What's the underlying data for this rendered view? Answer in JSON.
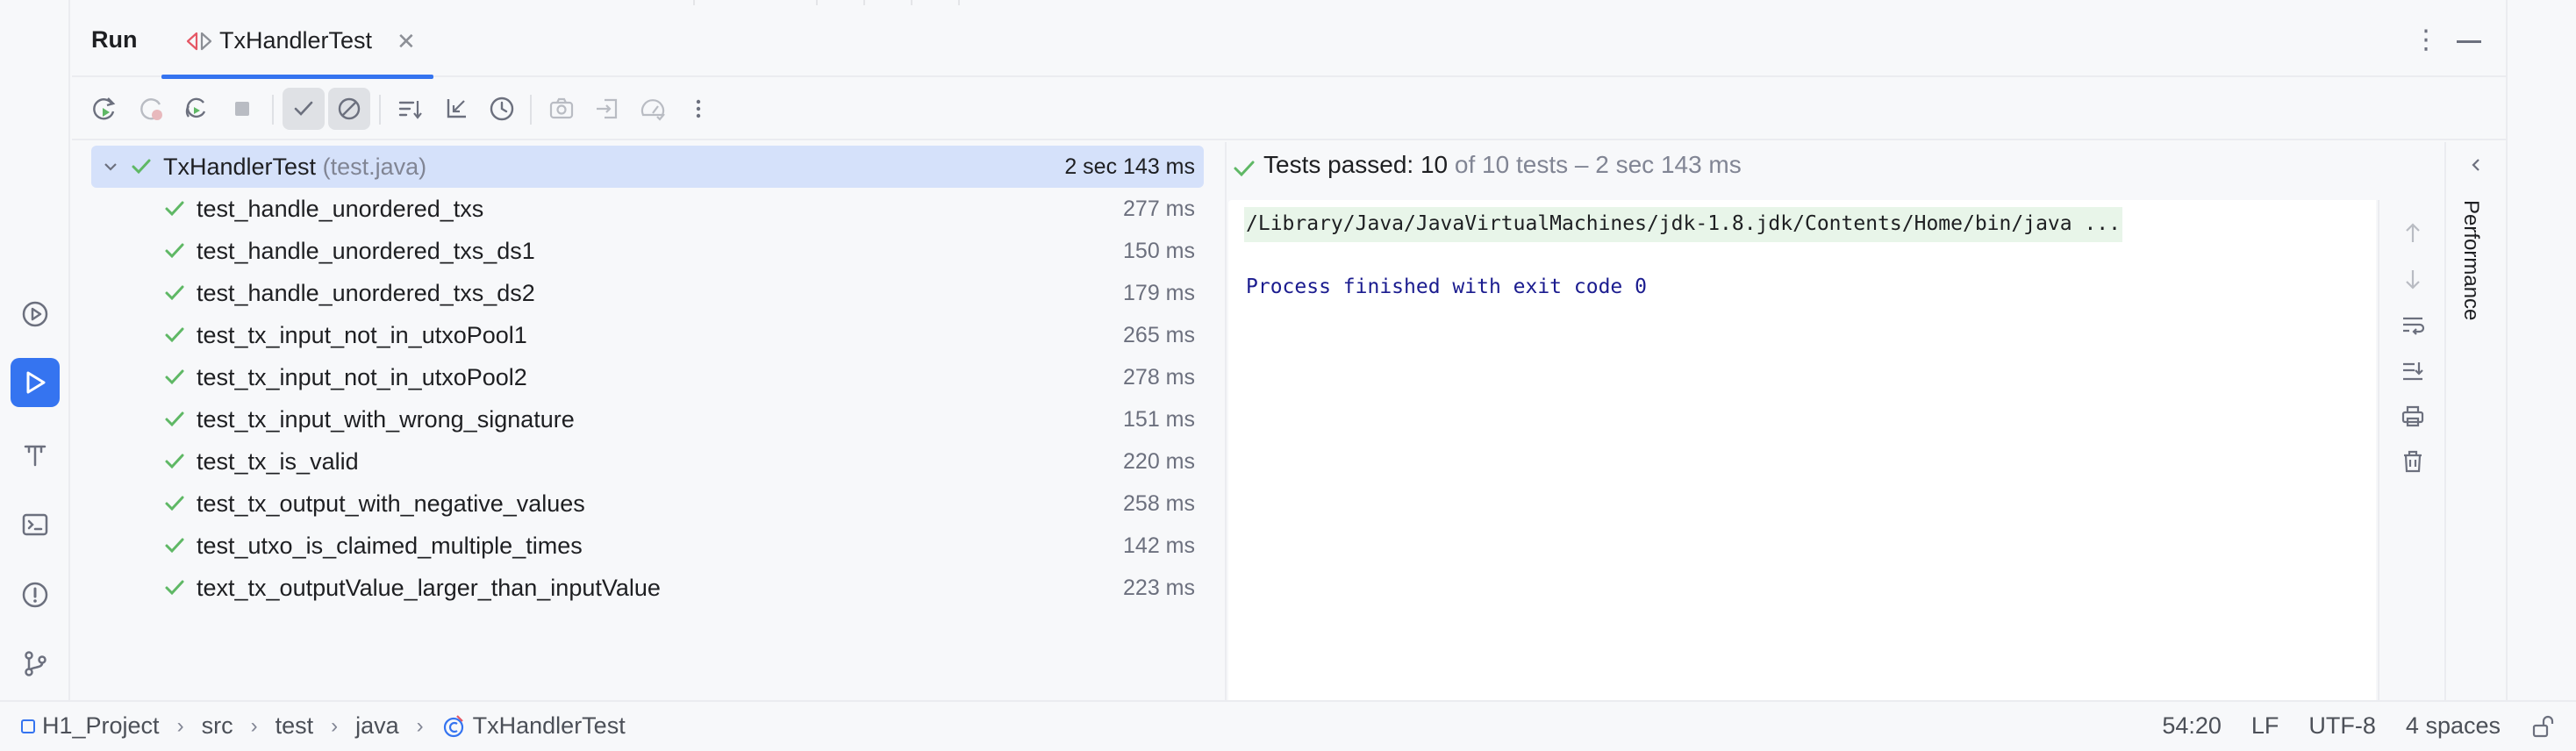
{
  "run_panel": {
    "title": "Run",
    "tab": {
      "label": "TxHandlerTest"
    }
  },
  "toolbar": {
    "buttons": [
      {
        "icon": "rerun-icon"
      },
      {
        "icon": "rerun-failed-icon"
      },
      {
        "icon": "toggle-auto-test-icon"
      },
      {
        "icon": "stop-icon"
      },
      {
        "icon": "show-passed-icon"
      },
      {
        "icon": "show-ignored-icon"
      },
      {
        "icon": "sort-alphabetically-icon"
      },
      {
        "icon": "sort-by-duration-icon"
      },
      {
        "icon": "test-history-icon"
      },
      {
        "icon": "export-icon"
      },
      {
        "icon": "import-icon"
      },
      {
        "icon": "coverage-icon"
      },
      {
        "icon": "more-icon"
      }
    ]
  },
  "tree": {
    "root": {
      "name": "TxHandlerTest",
      "sub": "(test.java)",
      "duration": "2 sec 143 ms"
    },
    "tests": [
      {
        "name": "test_handle_unordered_txs",
        "duration": "277 ms"
      },
      {
        "name": "test_handle_unordered_txs_ds1",
        "duration": "150 ms"
      },
      {
        "name": "test_handle_unordered_txs_ds2",
        "duration": "179 ms"
      },
      {
        "name": "test_tx_input_not_in_utxoPool1",
        "duration": "265 ms"
      },
      {
        "name": "test_tx_input_not_in_utxoPool2",
        "duration": "278 ms"
      },
      {
        "name": "test_tx_input_with_wrong_signature",
        "duration": "151 ms"
      },
      {
        "name": "test_tx_is_valid",
        "duration": "220 ms"
      },
      {
        "name": "test_tx_output_with_negative_values",
        "duration": "258 ms"
      },
      {
        "name": "test_utxo_is_claimed_multiple_times",
        "duration": "142 ms"
      },
      {
        "name": "text_tx_outputValue_larger_than_inputValue",
        "duration": "223 ms"
      }
    ]
  },
  "status": {
    "label": "Tests passed: ",
    "passed": "10",
    "rest": " of 10 tests – 2 sec 143 ms"
  },
  "console": {
    "command": "/Library/Java/JavaVirtualMachines/jdk-1.8.jdk/Contents/Home/bin/java ...",
    "exit_message": "Process finished with exit code 0"
  },
  "right_strip": {
    "performance_label": "Performance"
  },
  "statusbar": {
    "breadcrumbs": [
      "H1_Project",
      "src",
      "test",
      "java",
      "TxHandlerTest"
    ],
    "position": "54:20",
    "line_ending": "LF",
    "encoding": "UTF-8",
    "indent": "4 spaces"
  },
  "colors": {
    "accent": "#3574f0",
    "success": "#5fb865",
    "selection": "#d5e1fa"
  }
}
